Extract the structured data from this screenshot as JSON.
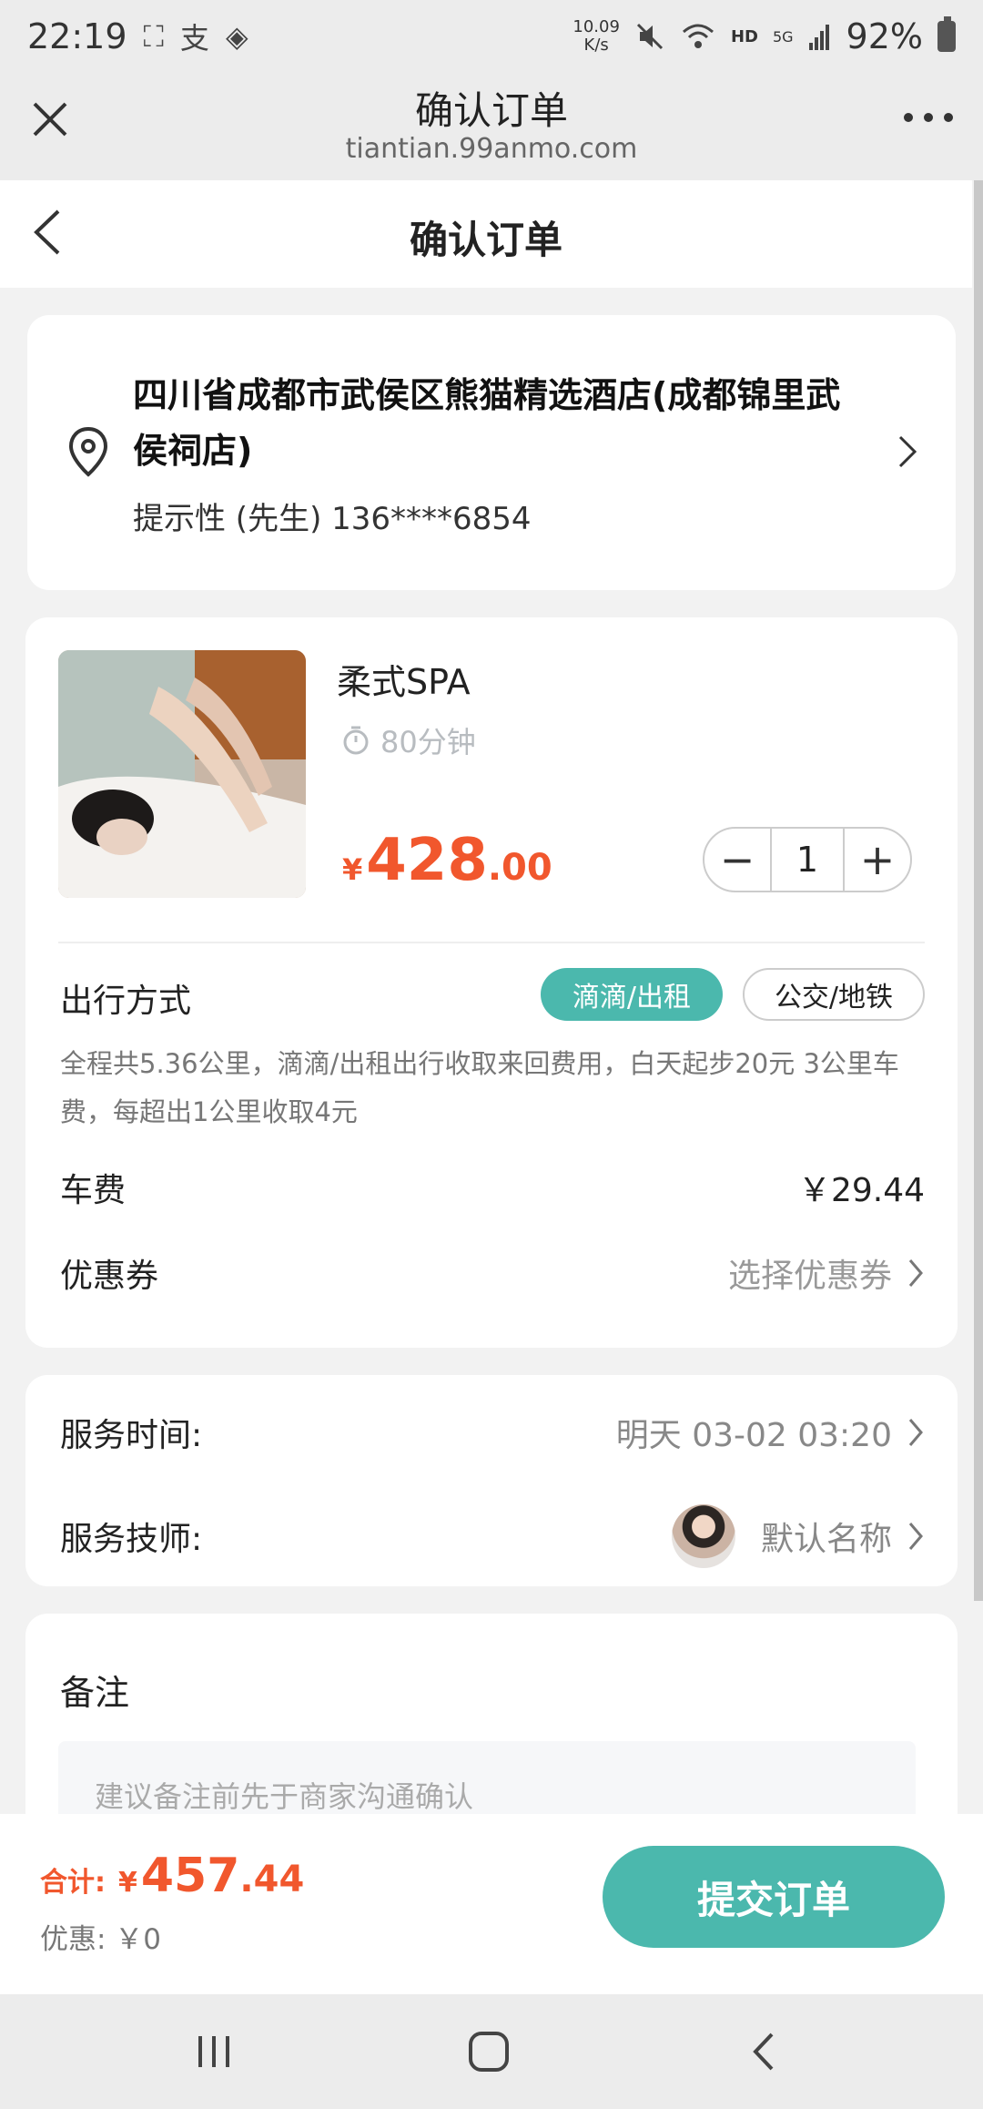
{
  "status_bar": {
    "time": "22:19",
    "net_speed_value": "10.09",
    "net_speed_unit": "K/s",
    "hd": "HD",
    "signal": "5G",
    "battery": "92%"
  },
  "browser": {
    "title": "确认订单",
    "url": "tiantian.99anmo.com"
  },
  "page": {
    "title": "确认订单"
  },
  "address": {
    "line1": "四川省成都市武侯区熊猫精选酒店(成都锦里武侯祠店)",
    "contact": "提示性 (先生) 136****6854"
  },
  "product": {
    "name": "柔式SPA",
    "duration": "80分钟",
    "price_symbol": "¥",
    "price_int": "428",
    "price_dec": ".00",
    "quantity": "1",
    "minus": "−",
    "plus": "+"
  },
  "travel": {
    "label": "出行方式",
    "option_taxi": "滴滴/出租",
    "option_transit": "公交/地铁",
    "selected": "滴滴/出租",
    "description": "全程共5.36公里，滴滴/出租出行收取来回费用，白天起步20元 3公里车费，每超出1公里收取4元",
    "fare_label": "车费",
    "fare_value": "￥29.44",
    "coupon_label": "优惠券",
    "coupon_value": "选择优惠券"
  },
  "service": {
    "time_label": "服务时间:",
    "time_value": "明天 03-02 03:20",
    "tech_label": "服务技师:",
    "tech_value": "默认名称"
  },
  "remark": {
    "title": "备注",
    "placeholder": "建议备注前先于商家沟通确认"
  },
  "footer": {
    "total_label": "合计:",
    "total_symbol": "¥",
    "total_int": "457",
    "total_dec": ".44",
    "discount": "优惠: ￥0",
    "submit": "提交订单"
  },
  "colors": {
    "accent": "#4bb8ad",
    "price": "#f1572d"
  }
}
